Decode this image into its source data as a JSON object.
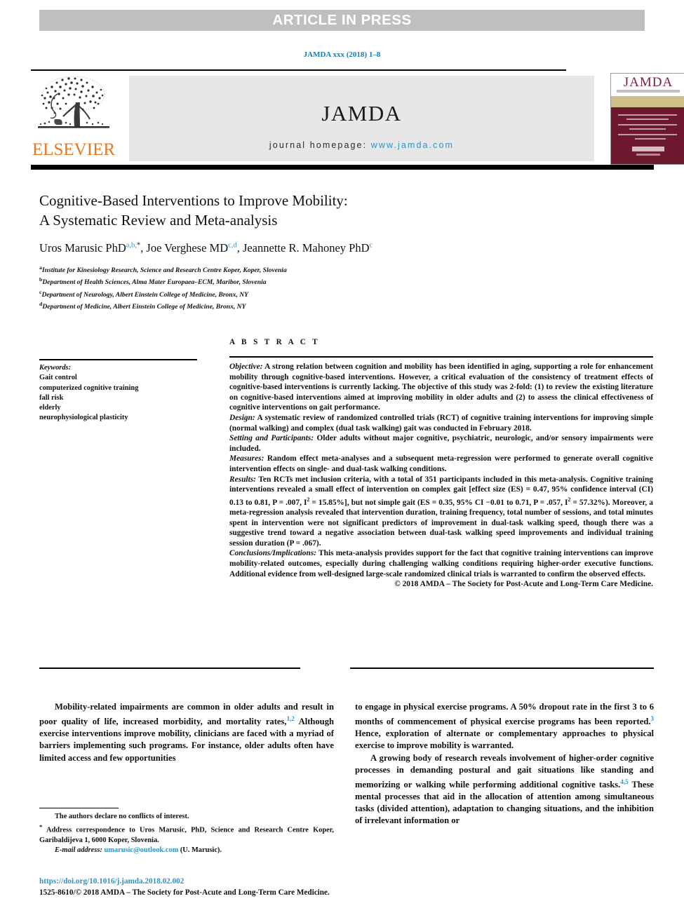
{
  "banner": {
    "text": "ARTICLE IN PRESS"
  },
  "citation": {
    "text": "JAMDA xxx (2018) 1–8"
  },
  "masthead": {
    "publisher": "ELSEVIER",
    "journal_name": "JAMDA",
    "homepage_label": "journal homepage:",
    "homepage_url": "www.jamda.com",
    "cover_title": "JAMDA"
  },
  "article": {
    "title_line1": "Cognitive-Based Interventions to Improve Mobility:",
    "title_line2": "A Systematic Review and Meta-analysis",
    "authors": [
      {
        "name": "Uros Marusic PhD",
        "marks": "a,b,",
        "star": "*",
        "sep": ", "
      },
      {
        "name": "Joe Verghese MD",
        "marks": "c,d",
        "star": "",
        "sep": ", "
      },
      {
        "name": "Jeannette R. Mahoney PhD",
        "marks": "c",
        "star": "",
        "sep": ""
      }
    ],
    "affiliations": [
      {
        "mark": "a",
        "text": "Institute for Kinesiology Research, Science and Research Centre Koper, Koper, Slovenia"
      },
      {
        "mark": "b",
        "text": "Department of Health Sciences, Alma Mater Europaea–ECM, Maribor, Slovenia"
      },
      {
        "mark": "c",
        "text": "Department of Neurology, Albert Einstein College of Medicine, Bronx, NY"
      },
      {
        "mark": "d",
        "text": "Department of Medicine, Albert Einstein College of Medicine, Bronx, NY"
      }
    ]
  },
  "keywords": {
    "heading": "Keywords:",
    "items": [
      "Gait control",
      "computerized cognitive training",
      "fall risk",
      "elderly",
      "neurophysiological plasticity"
    ]
  },
  "abstract": {
    "heading": "A B S T R A C T",
    "sections": [
      {
        "label": "Objective:",
        "text": " A strong relation between cognition and mobility has been identified in aging, supporting a role for enhancement mobility through cognitive-based interventions. However, a critical evaluation of the consistency of treatment effects of cognitive-based interventions is currently lacking. The objective of this study was 2-fold: (1) to review the existing literature on cognitive-based interventions aimed at improving mobility in older adults and (2) to assess the clinical effectiveness of cognitive interventions on gait performance."
      },
      {
        "label": "Design:",
        "text": " A systematic review of randomized controlled trials (RCT) of cognitive training interventions for improving simple (normal walking) and complex (dual task walking) gait was conducted in February 2018."
      },
      {
        "label": "Setting and Participants:",
        "text": " Older adults without major cognitive, psychiatric, neurologic, and/or sensory impairments were included."
      },
      {
        "label": "Measures:",
        "text": " Random effect meta-analyses and a subsequent meta-regression were performed to generate overall cognitive intervention effects on single- and dual-task walking conditions."
      },
      {
        "label": "Results:",
        "text": " Ten RCTs met inclusion criteria, with a total of 351 participants included in this meta-analysis. Cognitive training interventions revealed a small effect of intervention on complex gait [effect size (ES) = 0.47, 95% confidence interval (CI) 0.13 to 0.81, P = .007, I2 = 15.85%], but not simple gait (ES = 0.35, 95% CI −0.01 to 0.71, P = .057, I2 = 57.32%). Moreover, a meta-regression analysis revealed that intervention duration, training frequency, total number of sessions, and total minutes spent in intervention were not significant predictors of improvement in dual-task walking speed, though there was a suggestive trend toward a negative association between dual-task walking speed improvements and individual training session duration (P = .067)."
      },
      {
        "label": "Conclusions/Implications:",
        "text": " This meta-analysis provides support for the fact that cognitive training interventions can improve mobility-related outcomes, especially during challenging walking conditions requiring higher-order executive functions. Additional evidence from well-designed large-scale randomized clinical trials is warranted to confirm the observed effects."
      }
    ],
    "copyright": "© 2018 AMDA – The Society for Post-Acute and Long-Term Care Medicine."
  },
  "body": {
    "left_column": [
      {
        "part1": "Mobility-related impairments are common in older adults and result in poor quality of life, increased morbidity, and mortality rates,",
        "ref": "1,2",
        "part2": " Although exercise interventions improve mobility, clinicians are faced with a myriad of barriers implementing such programs. For instance, older adults often have limited access and few opportunities"
      }
    ],
    "right_column": [
      {
        "part1": "to engage in physical exercise programs. A 50% dropout rate in the first 3 to 6 months of commencement of physical exercise programs has been reported.",
        "ref": "3",
        "part2": " Hence, exploration of alternate or complementary approaches to physical exercise to improve mobility is warranted."
      },
      {
        "part1": "A growing body of research reveals involvement of higher-order cognitive processes in demanding postural and gait situations like standing and memorizing or walking while performing additional cognitive tasks.",
        "ref": "4,5",
        "part2": " These mental processes that aid in the allocation of attention among simultaneous tasks (divided attention), adaptation to changing situations, and the inhibition of irrelevant information or"
      }
    ]
  },
  "footnotes": {
    "conflict": "The authors declare no conflicts of interest.",
    "correspondence_star": "*",
    "correspondence": " Address correspondence to Uros Marusic, PhD, Science and Research Centre Koper, Garibaldijeva 1, 6000 Koper, Slovenia.",
    "email_label": "E-mail address:",
    "email": "umarusic@outlook.com",
    "email_suffix": " (U. Marusic)."
  },
  "footer": {
    "doi": "https://doi.org/10.1016/j.jamda.2018.02.002",
    "issn_line": "1525-8610/© 2018 AMDA – The Society for Post-Acute and Long-Term Care Medicine."
  },
  "colors": {
    "banner_bg": "#bfbfc1",
    "link": "#2e93c9",
    "citation": "#1a7bb0",
    "elsevier_orange": "#e87722",
    "band_grey": "#e7e7e7",
    "cover_maroon": "#6e1830",
    "cover_tan": "#cbc08a"
  }
}
